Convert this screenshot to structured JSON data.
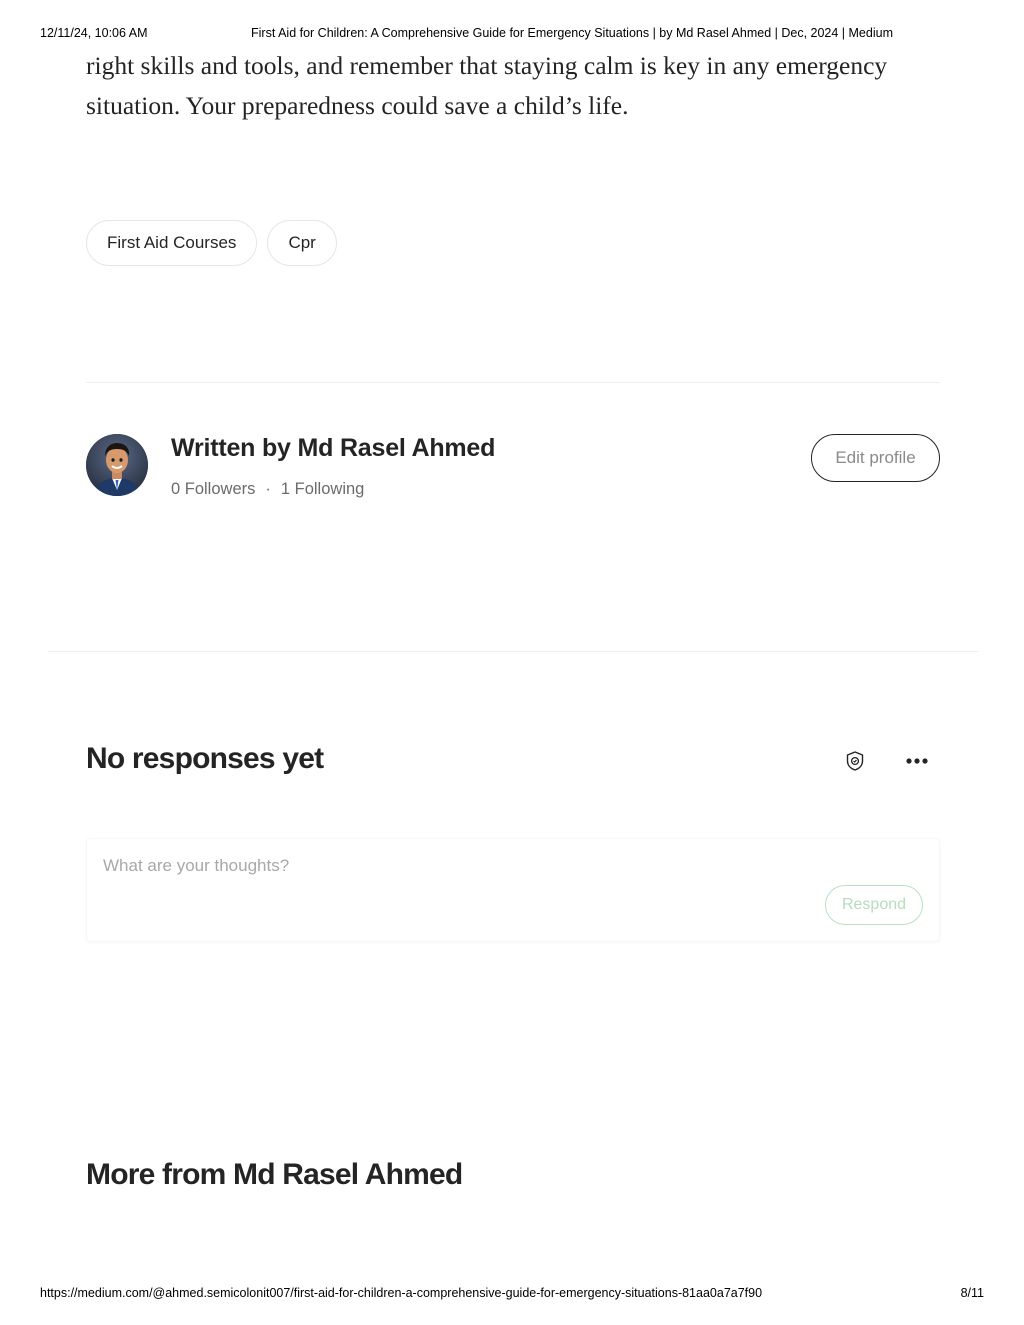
{
  "print_header": {
    "datetime": "12/11/24, 10:06 AM",
    "title": "First Aid for Children: A Comprehensive Guide for Emergency Situations | by Md Rasel Ahmed | Dec, 2024 | Medium"
  },
  "article": {
    "closing_text": "right skills and tools, and remember that staying calm is key in any emergency situation. Your preparedness could save a child’s life."
  },
  "tags": [
    {
      "label": "First Aid Courses"
    },
    {
      "label": "Cpr"
    }
  ],
  "author": {
    "written_by": "Written by Md Rasel Ahmed",
    "followers": "0 Followers",
    "separator": "·",
    "following": "1 Following",
    "edit_profile_label": "Edit profile"
  },
  "responses": {
    "title": "No responses yet",
    "input_placeholder": "What are your thoughts?",
    "respond_label": "Respond",
    "shield_icon": "shield-icon",
    "more_icon": "more-horizontal-icon"
  },
  "more_from": {
    "title": "More from Md Rasel Ahmed"
  },
  "print_footer": {
    "url": "https://medium.com/@ahmed.semicolonit007/first-aid-for-children-a-comprehensive-guide-for-emergency-situations-81aa0a7a7f90",
    "page": "8/11"
  },
  "colors": {
    "text": "#242424",
    "muted": "#6b6b6b",
    "respond_green": "#b8dcbd"
  }
}
